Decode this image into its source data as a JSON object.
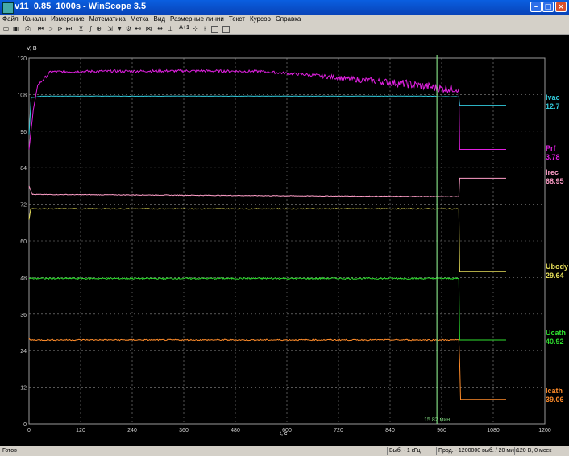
{
  "window": {
    "title": "v11_0.85_1000s - WinScope 3.5"
  },
  "menu": [
    "Файл",
    "Каналы",
    "Измерение",
    "Математика",
    "Метка",
    "Вид",
    "Размерные линии",
    "Текст",
    "Курсор",
    "Справка"
  ],
  "toolbar": {
    "icons": [
      "open-icon",
      "save-icon",
      "print-icon",
      "first-frame-icon",
      "play-icon",
      "step-forward-icon",
      "last-frame-icon",
      "fft-icon",
      "integrate-icon",
      "zoom-icon",
      "cursor-icon",
      "marker-icon",
      "settings-icon",
      "dimension-icon",
      "text-tool-icon",
      "crosshair-icon",
      "vertical-cursor-icon",
      "horizontal-cursor-icon"
    ],
    "text_label": "A+1"
  },
  "status": {
    "ready": "Готов",
    "sample_rate": "Выб. - 1 кГц",
    "duration": "Прод. - 1200000 выб. / 20 мин",
    "readout": "120 В, 0 мсек"
  },
  "chart_data": {
    "type": "line",
    "xlabel": "t, c",
    "ylabel": "V, B",
    "xlim": [
      0,
      1200
    ],
    "ylim": [
      0,
      120
    ],
    "x_ticks": [
      0,
      120,
      240,
      360,
      480,
      600,
      720,
      840,
      960,
      1080,
      1200
    ],
    "y_ticks": [
      0,
      12,
      24,
      36,
      48,
      60,
      72,
      84,
      96,
      108,
      120
    ],
    "grid": true,
    "background": "#000000",
    "cursor": {
      "x": 949,
      "label": "15.82 мин",
      "color": "#7fd67f"
    },
    "series": [
      {
        "name": "Ivac",
        "value_label": "12.7",
        "color": "#33ccdd",
        "points": [
          [
            0,
            95
          ],
          [
            5,
            107
          ],
          [
            30,
            107.5
          ],
          [
            945,
            107.5
          ],
          [
            949,
            107.3
          ],
          [
            1000,
            107.3
          ],
          [
            1002,
            104.5
          ],
          [
            1110,
            104.5
          ]
        ]
      },
      {
        "name": "Prf",
        "value_label": "3.78",
        "color": "#e020e0",
        "points": [
          [
            0,
            90
          ],
          [
            10,
            103
          ],
          [
            20,
            111
          ],
          [
            50,
            115.5
          ],
          [
            200,
            115.7
          ],
          [
            400,
            115.8
          ],
          [
            540,
            115.6
          ],
          [
            650,
            114.5
          ],
          [
            760,
            113
          ],
          [
            880,
            111.5
          ],
          [
            960,
            110
          ],
          [
            1000,
            110
          ],
          [
            1002,
            90
          ],
          [
            1110,
            90
          ]
        ]
      },
      {
        "name": "Irec",
        "value_label": "68.95",
        "color": "#ff9ec8",
        "points": [
          [
            0,
            78
          ],
          [
            8,
            75.2
          ],
          [
            200,
            75.1
          ],
          [
            600,
            74.8
          ],
          [
            1000,
            74.5
          ],
          [
            1002,
            80.5
          ],
          [
            1110,
            80.5
          ]
        ]
      },
      {
        "name": "Ubody",
        "value_label": "29.64",
        "color": "#e8e05a",
        "points": [
          [
            0,
            67
          ],
          [
            4,
            70.5
          ],
          [
            1000,
            70.5
          ],
          [
            1002,
            50
          ],
          [
            1110,
            50
          ]
        ]
      },
      {
        "name": "Ucath",
        "value_label": "40.92",
        "color": "#2fe02f",
        "points": [
          [
            0,
            47.7
          ],
          [
            1000,
            47.7
          ],
          [
            1002,
            27.5
          ],
          [
            1110,
            27.5
          ]
        ]
      },
      {
        "name": "Icath",
        "value_label": "39.06",
        "color": "#ff8c2a",
        "points": [
          [
            0,
            28
          ],
          [
            3,
            27.5
          ],
          [
            1000,
            27.5
          ],
          [
            1002,
            20
          ],
          [
            1004,
            8
          ],
          [
            1110,
            8
          ]
        ]
      }
    ]
  }
}
